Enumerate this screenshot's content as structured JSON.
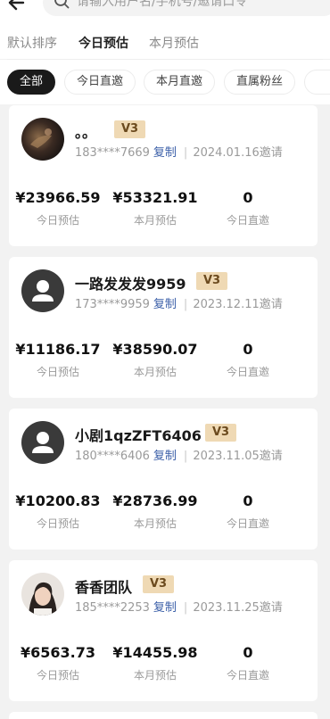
{
  "search": {
    "placeholder": "请输入用户名/手机号/邀请口令"
  },
  "sort_tabs": [
    {
      "label": "默认排序",
      "active": false
    },
    {
      "label": "今日预估",
      "active": true
    },
    {
      "label": "本月预估",
      "active": false
    }
  ],
  "filter_chips": [
    {
      "label": "全部",
      "active": true
    },
    {
      "label": "今日直邀",
      "active": false
    },
    {
      "label": "本月直邀",
      "active": false
    },
    {
      "label": "直属粉丝",
      "active": false
    }
  ],
  "copy_label": "复制",
  "stat_labels": {
    "today_estimate": "今日预估",
    "month_estimate": "本月预估",
    "today_direct": "今日直邀"
  },
  "members": [
    {
      "name": "。。",
      "level": "V3",
      "phone": "183****7669",
      "invited": "2024.01.16邀请",
      "today_estimate": "¥23966.59",
      "month_estimate": "¥53321.91",
      "today_direct": "0",
      "avatar": "photo-dark"
    },
    {
      "name": "一路发发发9959",
      "level": "V3",
      "phone": "173****9959",
      "invited": "2023.12.11邀请",
      "today_estimate": "¥11186.17",
      "month_estimate": "¥38590.07",
      "today_direct": "0",
      "avatar": "default-user"
    },
    {
      "name": "小剧1qzZFT6406",
      "level": "V3",
      "phone": "180****6406",
      "invited": "2023.11.05邀请",
      "today_estimate": "¥10200.83",
      "month_estimate": "¥28736.99",
      "today_direct": "0",
      "avatar": "default-user"
    },
    {
      "name": "香香团队",
      "level": "V3",
      "phone": "185****2253",
      "invited": "2023.11.25邀请",
      "today_estimate": "¥6563.73",
      "month_estimate": "¥14455.98",
      "today_direct": "0",
      "avatar": "photo-person"
    }
  ],
  "colors": {
    "accent_dark": "#1a1a1a",
    "badge_bg": "#efd9b4",
    "badge_text": "#6b4a1e",
    "link_blue": "#3b5fa8",
    "page_bg": "#f2f2f2"
  }
}
